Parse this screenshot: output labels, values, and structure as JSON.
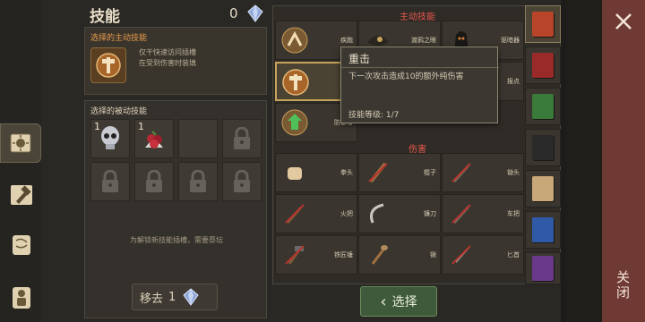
{
  "panel": {
    "title": "技能",
    "gem_count": "0",
    "icon": "crystal-gem-icon"
  },
  "selected_active": {
    "header": "选择的主动技能",
    "desc_line1": "仅干快速访问插槽",
    "desc_line2": "在受到伤害时装填",
    "icon": "heavy-strike-icon"
  },
  "passive": {
    "header": "选择的被动技能",
    "slots": [
      {
        "count": "1",
        "icon": "skull-icon"
      },
      {
        "count": "1",
        "icon": "berries-icon"
      }
    ],
    "unlock_note": "为解锁新技能插槽，需要祭坛",
    "remove_label": "移去",
    "remove_count": "1"
  },
  "active_section": {
    "title": "主动技能",
    "items": [
      {
        "name": "疾跑",
        "icon": "sprint-icon"
      },
      {
        "name": "渡鸦之眼",
        "icon": "raven-eye-icon"
      },
      {
        "name": "驱暗器",
        "icon": "hooded-figure-icon"
      },
      {
        "name": "重击",
        "icon": "heavy-strike-icon"
      },
      {
        "name": "报点",
        "icon": "mark-icon"
      },
      {
        "name": "防御者",
        "icon": "defender-icon"
      }
    ]
  },
  "damage_section": {
    "title": "伤害",
    "items": [
      {
        "name": "拳头",
        "icon": "fist-icon"
      },
      {
        "name": "棍子",
        "icon": "stick-icon"
      },
      {
        "name": "锄头",
        "icon": "hoe-icon"
      },
      {
        "name": "火把",
        "icon": "torch-icon"
      },
      {
        "name": "镰刀",
        "icon": "sickle-icon"
      },
      {
        "name": "车把",
        "icon": "handle-icon"
      },
      {
        "name": "铁匠锤",
        "icon": "smith-hammer-icon"
      },
      {
        "name": "锹",
        "icon": "shovel-icon"
      },
      {
        "name": "匕首",
        "icon": "dagger-icon"
      }
    ]
  },
  "tooltip": {
    "title": "重击",
    "desc": "下一次攻击造成10的额外纯伤害",
    "level": "技能等级: 1/7"
  },
  "select_button": {
    "label": "选择"
  },
  "close": {
    "label": "关闭"
  },
  "colors": {
    "accent_red": "#e8574a",
    "active_header": "#e89a4c",
    "close_bg": "#703a34",
    "select_bg": "#3f5a3a"
  }
}
